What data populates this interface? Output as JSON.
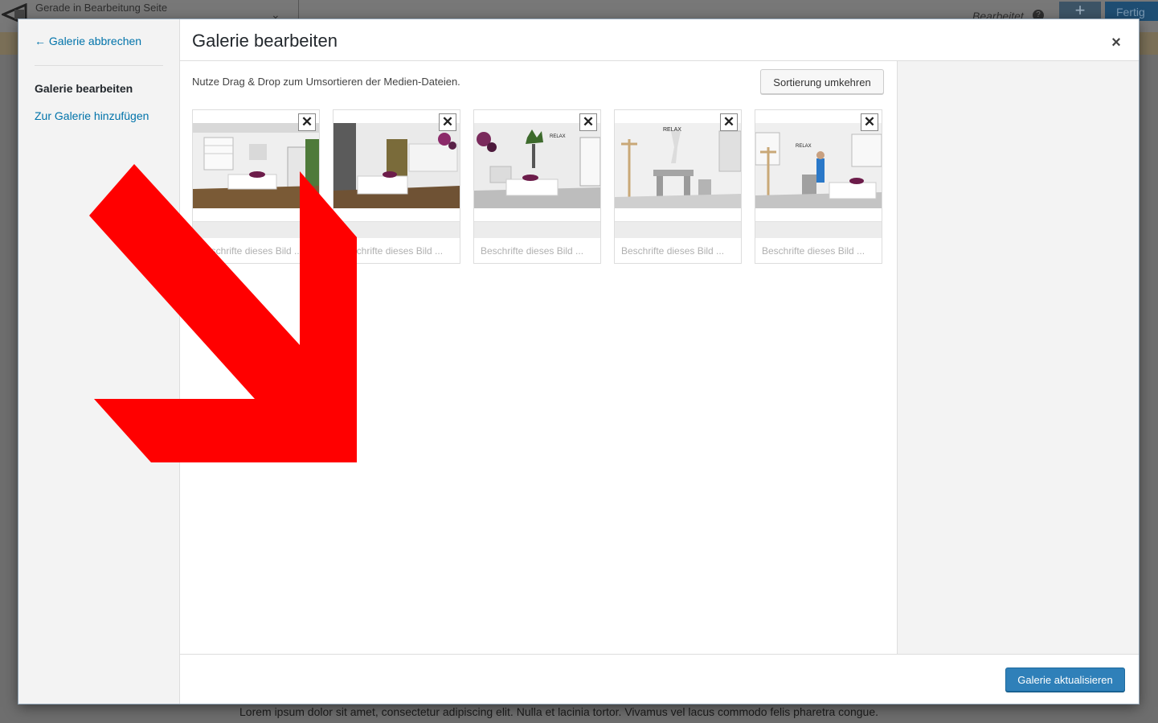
{
  "background": {
    "editing_label": "Gerade in Bearbeitung Seite",
    "status_label": "Bearbeitet",
    "done_label": "Fertig",
    "lorem": "Lorem ipsum dolor sit amet, consectetur adipiscing elit. Nulla et lacinia tortor. Vivamus vel lacus commodo felis pharetra congue."
  },
  "menu": {
    "cancel_label": "← Galerie abbrechen",
    "active_label": "Galerie bearbeiten",
    "add_label": "Zur Galerie hinzufügen"
  },
  "header": {
    "title": "Galerie bearbeiten",
    "close_symbol": "×"
  },
  "content": {
    "instructions": "Nutze Drag & Drop zum Umsortieren der Medien-Dateien.",
    "reverse_label": "Sortierung umkehren"
  },
  "attachments": [
    {
      "caption_placeholder": "Beschrifte dieses Bild ...",
      "remove_symbol": "✕"
    },
    {
      "caption_placeholder": "Beschrifte dieses Bild ...",
      "remove_symbol": "✕"
    },
    {
      "caption_placeholder": "Beschrifte dieses Bild ...",
      "remove_symbol": "✕"
    },
    {
      "caption_placeholder": "Beschrifte dieses Bild ...",
      "remove_symbol": "✕"
    },
    {
      "caption_placeholder": "Beschrifte dieses Bild ...",
      "remove_symbol": "✕"
    }
  ],
  "toolbar": {
    "update_label": "Galerie aktualisieren"
  },
  "colors": {
    "accent": "#0073aa",
    "primary_button": "#2f80b9",
    "annotation_arrow": "#ff0000"
  }
}
